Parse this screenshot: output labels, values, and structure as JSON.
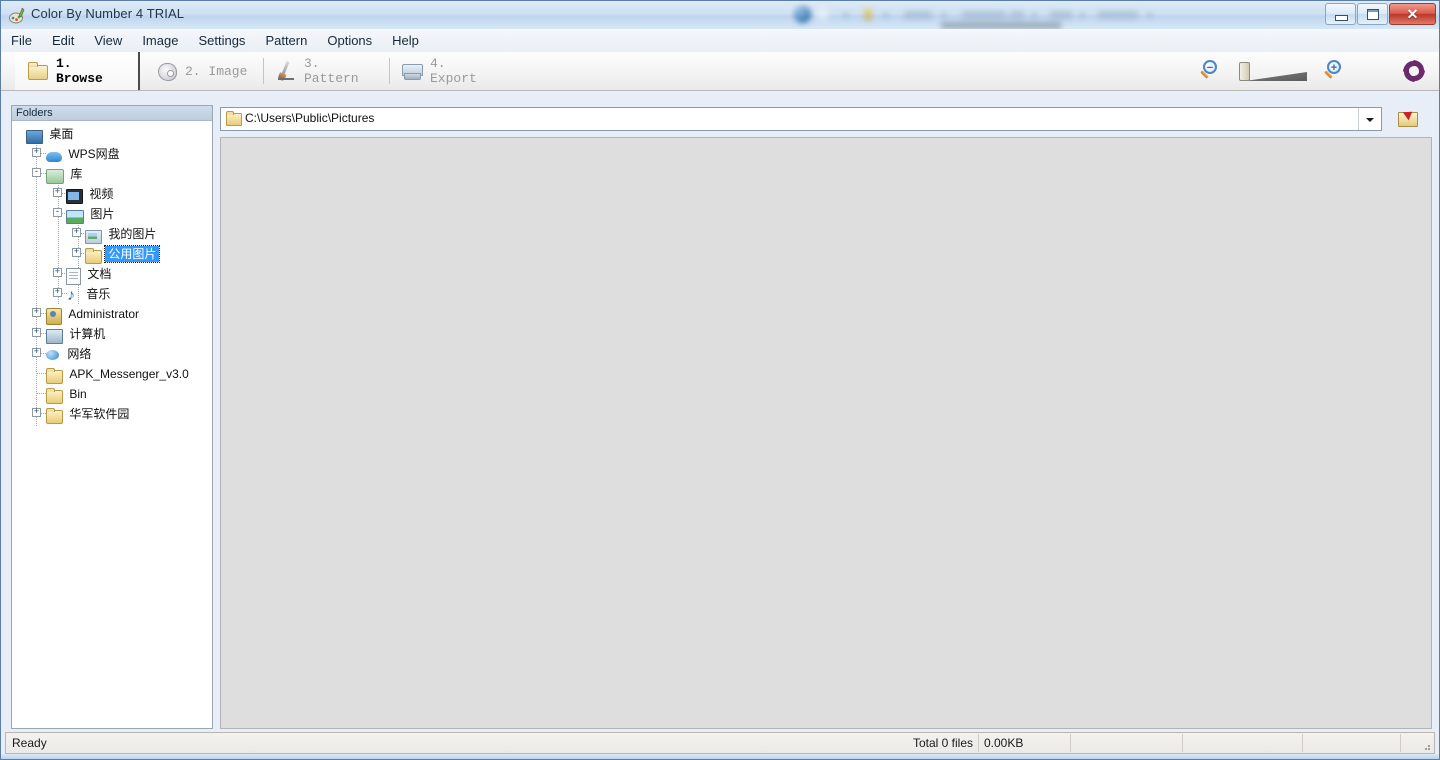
{
  "window": {
    "title": "Color By Number 4 TRIAL",
    "app_icon": "palette-brush-icon",
    "controls": {
      "minimize": "minimize-button",
      "restore": "restore-button",
      "close_glyph": "✕"
    }
  },
  "menubar": {
    "items": [
      {
        "label": "File"
      },
      {
        "label": "Edit"
      },
      {
        "label": "View"
      },
      {
        "label": "Image"
      },
      {
        "label": "Settings"
      },
      {
        "label": "Pattern"
      },
      {
        "label": "Options"
      },
      {
        "label": "Help"
      }
    ]
  },
  "toolbar": {
    "steps": [
      {
        "label": "1. Browse",
        "icon": "folder-icon",
        "active": true
      },
      {
        "label": "2. Image",
        "icon": "palette-icon",
        "active": false
      },
      {
        "label": "3. Pattern",
        "icon": "brush-icon",
        "active": false
      },
      {
        "label": "4. Export",
        "icon": "export-icon",
        "active": false
      }
    ],
    "zoom_out": "zoom-out-icon",
    "zoom_in": "zoom-in-icon",
    "zoom_slider": "zoom-slider",
    "brand": "spiral-logo"
  },
  "tree": {
    "header": "Folders",
    "nodes": [
      {
        "label": "桌面",
        "icon": "desktop-icon",
        "depth": 0,
        "expander": "",
        "selected": false
      },
      {
        "label": "WPS网盘",
        "icon": "cloud-icon",
        "depth": 1,
        "expander": "+",
        "selected": false
      },
      {
        "label": "库",
        "icon": "library-icon",
        "depth": 1,
        "expander": "-",
        "selected": false
      },
      {
        "label": "视频",
        "icon": "video-icon",
        "depth": 2,
        "expander": "+",
        "selected": false
      },
      {
        "label": "图片",
        "icon": "picture-icon",
        "depth": 2,
        "expander": "-",
        "selected": false
      },
      {
        "label": "我的图片",
        "icon": "folder-picture-icon",
        "depth": 3,
        "expander": "+",
        "selected": false
      },
      {
        "label": "公用图片",
        "icon": "folder-yellow-icon",
        "depth": 3,
        "expander": "+",
        "selected": true
      },
      {
        "label": "文档",
        "icon": "document-icon",
        "depth": 2,
        "expander": "+",
        "selected": false
      },
      {
        "label": "音乐",
        "icon": "music-icon",
        "depth": 2,
        "expander": "+",
        "selected": false
      },
      {
        "label": "Administrator",
        "icon": "user-icon",
        "depth": 1,
        "expander": "+",
        "selected": false
      },
      {
        "label": "计算机",
        "icon": "computer-icon",
        "depth": 1,
        "expander": "+",
        "selected": false
      },
      {
        "label": "网络",
        "icon": "network-icon",
        "depth": 1,
        "expander": "+",
        "selected": false
      },
      {
        "label": "APK_Messenger_v3.0",
        "icon": "folder-yellow-icon",
        "depth": 1,
        "expander": "",
        "selected": false
      },
      {
        "label": "Bin",
        "icon": "folder-yellow-icon",
        "depth": 1,
        "expander": "",
        "selected": false
      },
      {
        "label": "华军软件园",
        "icon": "folder-yellow-icon",
        "depth": 1,
        "expander": "+",
        "selected": false
      }
    ]
  },
  "address": {
    "path": "C:\\Users\\Public\\Pictures",
    "folder_icon": "folder-icon",
    "dropdown_icon": "chevron-down-icon",
    "open_button": "open-folder-button"
  },
  "status": {
    "ready": "Ready",
    "total_files": "Total 0 files",
    "total_size": "0.00KB",
    "cell4": "",
    "cell5": "",
    "cell6": "",
    "cell7": ""
  },
  "colors": {
    "accent": "#3399ff",
    "titlebar": "#cfe0f2",
    "content_bg": "#dedede",
    "brand_purple": "#6b2a6e"
  }
}
